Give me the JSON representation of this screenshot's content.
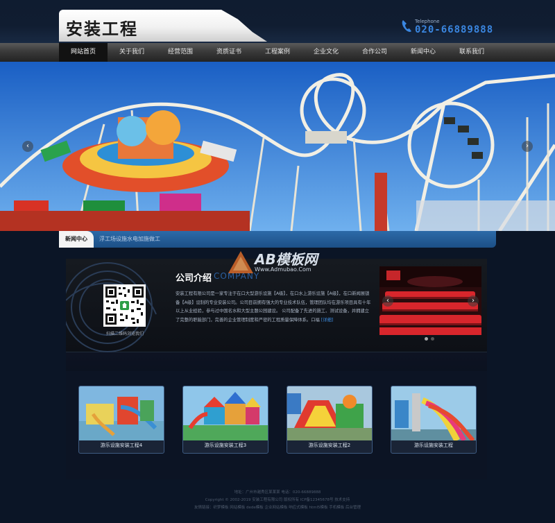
{
  "header": {
    "logo_text": "安装工程",
    "telephone_label": "Telephone",
    "telephone_number": "020-66889888"
  },
  "nav": {
    "items": [
      "网站首页",
      "关于我们",
      "经营范围",
      "资质证书",
      "工程案例",
      "企业文化",
      "合作公司",
      "新闻中心",
      "联系我们"
    ],
    "active": 0
  },
  "banner": {
    "prev_label": "‹",
    "next_label": "›"
  },
  "ticker": {
    "label": "新闻中心",
    "text": "浮工场设施水电加施做工"
  },
  "about": {
    "title": "公司介绍",
    "title_en": "COMPANY",
    "text": "安装工程有限公司是一家专注于在口大型游乐设施【A级】，在口水上游乐设施【A级】，在口新闻展锁备【A级】设制的专业安装公司。公司目前拥有强大的专业技术队伍，管理团队均在游乐项目具有十年以上从业经验，参与过中国名水和大型主题公园建设。 公司配备了先进的施工、测试设备，并拥建立了完整的职能部门，完善的企业管理制度和严密的工程质量保障体系。口福",
    "more": "[详细]",
    "qr_caption": "扫描二维码浏览我们"
  },
  "watermark": {
    "text": "AB模板网",
    "url": "Www.Admubao.Com"
  },
  "projects": [
    {
      "caption": "游乐设施安装工程4"
    },
    {
      "caption": "游乐设施安装工程3"
    },
    {
      "caption": "游乐设施安装工程2"
    },
    {
      "caption": "游乐设施安装工程"
    }
  ],
  "footer": {
    "line1": "地址：广州市越秀区某某某 电话：020-66889888",
    "line2": "Copyright © 2002-2019 安装工程有限公司 版权所有 ICP备12345678号 技术支持",
    "line3": "友情链接：织梦模板 网站模板 dede模板 企业网站模板 响应式模板 html5模板 手机模板 后台管理"
  }
}
